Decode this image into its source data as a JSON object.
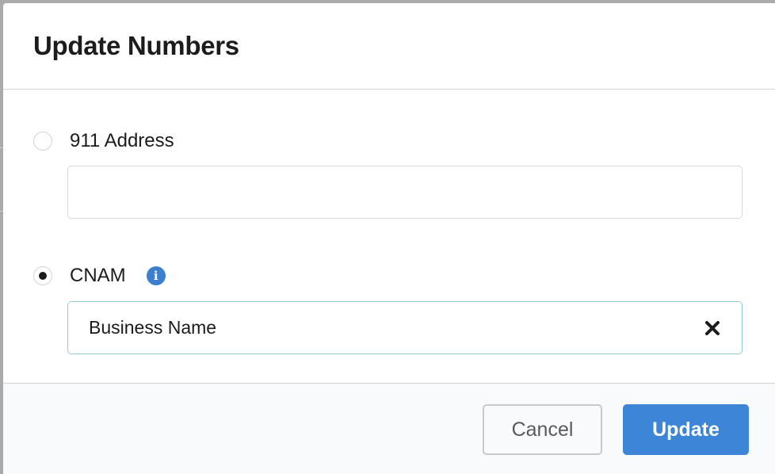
{
  "modal": {
    "title": "Update Numbers"
  },
  "options": {
    "address": {
      "label": "911 Address",
      "selected": false,
      "value": "",
      "placeholder": ""
    },
    "cnam": {
      "label": "CNAM",
      "selected": true,
      "value": "Business Name",
      "info_icon": "info-circle-icon",
      "clear_icon": "close-icon"
    }
  },
  "actions": {
    "cancel_label": "Cancel",
    "update_label": "Update"
  },
  "colors": {
    "primary": "#3d85d6",
    "info": "#3d7fcf",
    "focus_border": "#96c8da",
    "footer_bg": "#f9fafb"
  }
}
